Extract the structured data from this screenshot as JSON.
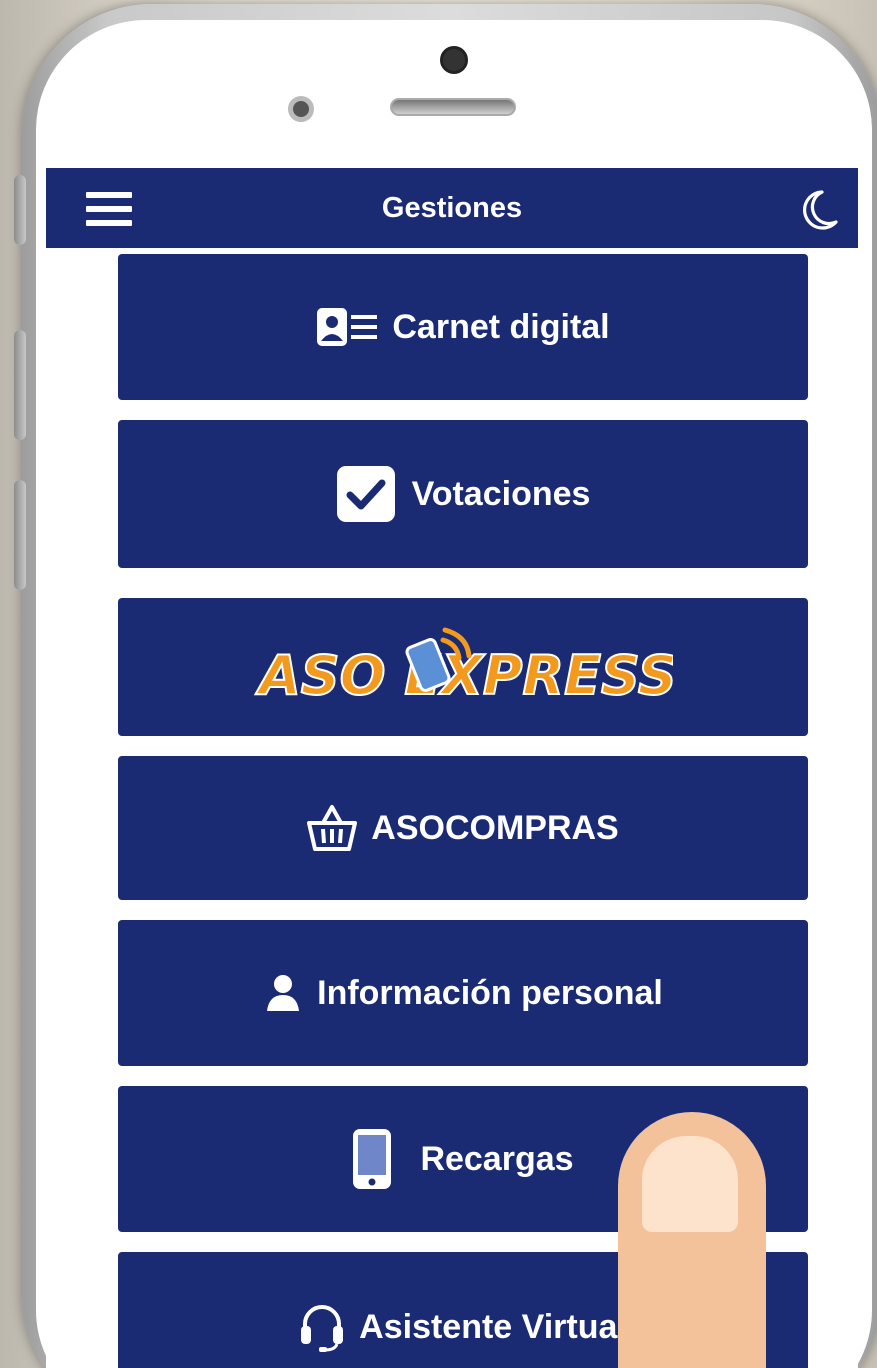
{
  "app_bar": {
    "title": "Gestiones",
    "menu_icon": "hamburger-icon",
    "theme_icon": "moon-icon"
  },
  "menu": [
    {
      "label": "Carnet digital",
      "icon": "id-card-icon"
    },
    {
      "label": "Votaciones",
      "icon": "checkbox-icon"
    },
    {
      "label": "ASO EXPRESS",
      "icon": "asoexpress-logo"
    },
    {
      "label": "ASOCOMPRAS",
      "icon": "basket-icon"
    },
    {
      "label": "Información personal",
      "icon": "user-icon"
    },
    {
      "label": "Recargas",
      "icon": "phone-icon"
    },
    {
      "label": "Asistente Virtual",
      "icon": "headset-icon"
    }
  ],
  "colors": {
    "primary": "#1b2b73",
    "logo_orange": "#f39a1e",
    "logo_blue": "#5b8fd6"
  }
}
